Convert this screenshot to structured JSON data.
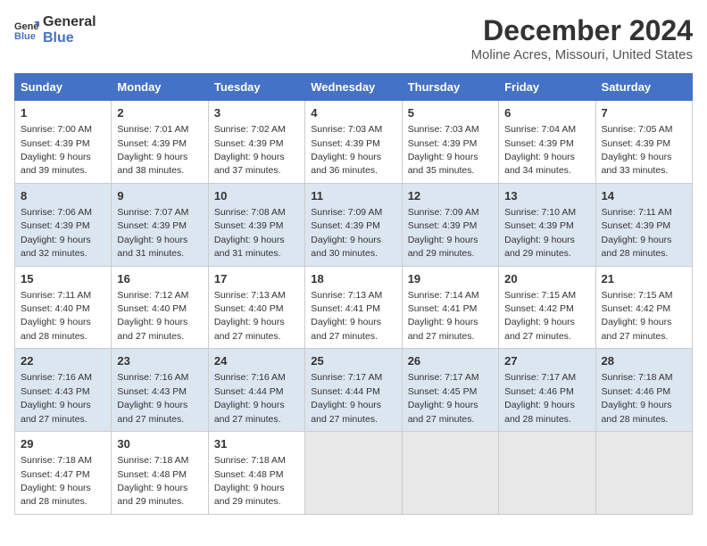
{
  "logo": {
    "general": "General",
    "blue": "Blue"
  },
  "title": "December 2024",
  "subtitle": "Moline Acres, Missouri, United States",
  "days_of_week": [
    "Sunday",
    "Monday",
    "Tuesday",
    "Wednesday",
    "Thursday",
    "Friday",
    "Saturday"
  ],
  "weeks": [
    [
      {
        "day": "1",
        "sunrise": "7:00 AM",
        "sunset": "4:39 PM",
        "daylight": "9 hours and 39 minutes."
      },
      {
        "day": "2",
        "sunrise": "7:01 AM",
        "sunset": "4:39 PM",
        "daylight": "9 hours and 38 minutes."
      },
      {
        "day": "3",
        "sunrise": "7:02 AM",
        "sunset": "4:39 PM",
        "daylight": "9 hours and 37 minutes."
      },
      {
        "day": "4",
        "sunrise": "7:03 AM",
        "sunset": "4:39 PM",
        "daylight": "9 hours and 36 minutes."
      },
      {
        "day": "5",
        "sunrise": "7:03 AM",
        "sunset": "4:39 PM",
        "daylight": "9 hours and 35 minutes."
      },
      {
        "day": "6",
        "sunrise": "7:04 AM",
        "sunset": "4:39 PM",
        "daylight": "9 hours and 34 minutes."
      },
      {
        "day": "7",
        "sunrise": "7:05 AM",
        "sunset": "4:39 PM",
        "daylight": "9 hours and 33 minutes."
      }
    ],
    [
      {
        "day": "8",
        "sunrise": "7:06 AM",
        "sunset": "4:39 PM",
        "daylight": "9 hours and 32 minutes."
      },
      {
        "day": "9",
        "sunrise": "7:07 AM",
        "sunset": "4:39 PM",
        "daylight": "9 hours and 31 minutes."
      },
      {
        "day": "10",
        "sunrise": "7:08 AM",
        "sunset": "4:39 PM",
        "daylight": "9 hours and 31 minutes."
      },
      {
        "day": "11",
        "sunrise": "7:09 AM",
        "sunset": "4:39 PM",
        "daylight": "9 hours and 30 minutes."
      },
      {
        "day": "12",
        "sunrise": "7:09 AM",
        "sunset": "4:39 PM",
        "daylight": "9 hours and 29 minutes."
      },
      {
        "day": "13",
        "sunrise": "7:10 AM",
        "sunset": "4:39 PM",
        "daylight": "9 hours and 29 minutes."
      },
      {
        "day": "14",
        "sunrise": "7:11 AM",
        "sunset": "4:39 PM",
        "daylight": "9 hours and 28 minutes."
      }
    ],
    [
      {
        "day": "15",
        "sunrise": "7:11 AM",
        "sunset": "4:40 PM",
        "daylight": "9 hours and 28 minutes."
      },
      {
        "day": "16",
        "sunrise": "7:12 AM",
        "sunset": "4:40 PM",
        "daylight": "9 hours and 27 minutes."
      },
      {
        "day": "17",
        "sunrise": "7:13 AM",
        "sunset": "4:40 PM",
        "daylight": "9 hours and 27 minutes."
      },
      {
        "day": "18",
        "sunrise": "7:13 AM",
        "sunset": "4:41 PM",
        "daylight": "9 hours and 27 minutes."
      },
      {
        "day": "19",
        "sunrise": "7:14 AM",
        "sunset": "4:41 PM",
        "daylight": "9 hours and 27 minutes."
      },
      {
        "day": "20",
        "sunrise": "7:15 AM",
        "sunset": "4:42 PM",
        "daylight": "9 hours and 27 minutes."
      },
      {
        "day": "21",
        "sunrise": "7:15 AM",
        "sunset": "4:42 PM",
        "daylight": "9 hours and 27 minutes."
      }
    ],
    [
      {
        "day": "22",
        "sunrise": "7:16 AM",
        "sunset": "4:43 PM",
        "daylight": "9 hours and 27 minutes."
      },
      {
        "day": "23",
        "sunrise": "7:16 AM",
        "sunset": "4:43 PM",
        "daylight": "9 hours and 27 minutes."
      },
      {
        "day": "24",
        "sunrise": "7:16 AM",
        "sunset": "4:44 PM",
        "daylight": "9 hours and 27 minutes."
      },
      {
        "day": "25",
        "sunrise": "7:17 AM",
        "sunset": "4:44 PM",
        "daylight": "9 hours and 27 minutes."
      },
      {
        "day": "26",
        "sunrise": "7:17 AM",
        "sunset": "4:45 PM",
        "daylight": "9 hours and 27 minutes."
      },
      {
        "day": "27",
        "sunrise": "7:17 AM",
        "sunset": "4:46 PM",
        "daylight": "9 hours and 28 minutes."
      },
      {
        "day": "28",
        "sunrise": "7:18 AM",
        "sunset": "4:46 PM",
        "daylight": "9 hours and 28 minutes."
      }
    ],
    [
      {
        "day": "29",
        "sunrise": "7:18 AM",
        "sunset": "4:47 PM",
        "daylight": "9 hours and 28 minutes."
      },
      {
        "day": "30",
        "sunrise": "7:18 AM",
        "sunset": "4:48 PM",
        "daylight": "9 hours and 29 minutes."
      },
      {
        "day": "31",
        "sunrise": "7:18 AM",
        "sunset": "4:48 PM",
        "daylight": "9 hours and 29 minutes."
      },
      null,
      null,
      null,
      null
    ]
  ]
}
